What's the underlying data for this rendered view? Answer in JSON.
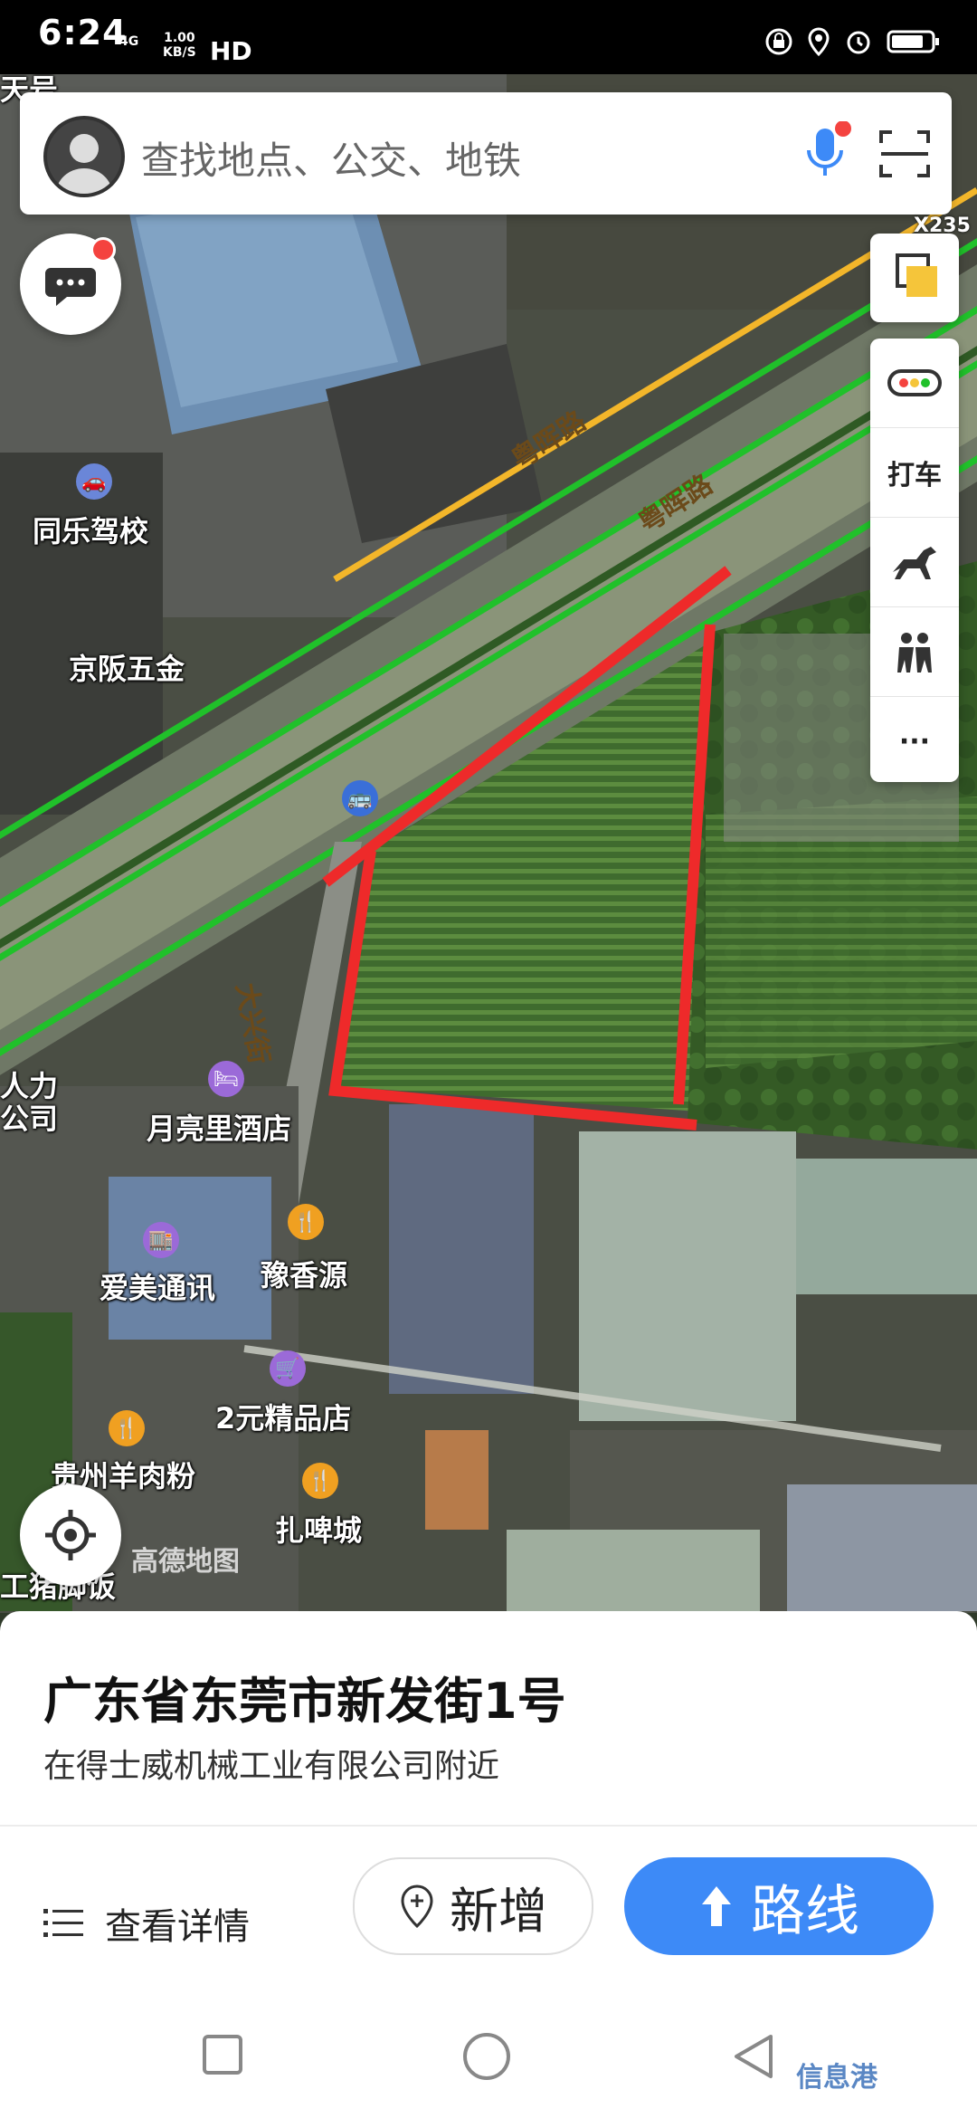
{
  "status_bar": {
    "time": "6:24",
    "network": "4G",
    "speed_value": "1.00",
    "speed_unit": "KB/S",
    "hd": "HD"
  },
  "search": {
    "placeholder": "查找地点、公交、地铁"
  },
  "map": {
    "scale_tag": "X235",
    "roads": [
      "粤晖路",
      "粤晖路",
      "大兴街"
    ],
    "pois": [
      {
        "name": "同乐驾校",
        "icon": "car-icon"
      },
      {
        "name": "京阪五金",
        "icon": "dot-icon"
      },
      {
        "name": "月亮里酒店",
        "icon": "bed-icon"
      },
      {
        "name": "人力\n公司",
        "icon": "none"
      },
      {
        "name": "豫香源",
        "icon": "restaurant-icon"
      },
      {
        "name": "爱美通讯",
        "icon": "shop-icon"
      },
      {
        "name": "2元精品店",
        "icon": "cart-icon"
      },
      {
        "name": "贵州羊肉粉",
        "icon": "restaurant-icon"
      },
      {
        "name": "扎啤城",
        "icon": "restaurant-icon"
      },
      {
        "name": "工猪脚饭",
        "icon": "restaurant-icon"
      }
    ],
    "logo_text": "高德地图",
    "top_left_partial": "天号"
  },
  "tools": {
    "taxi_label": "打车",
    "more": "···"
  },
  "sheet": {
    "address": "广东省东莞市新发街1号",
    "nearby": "在得士威机械工业有限公司附近",
    "detail_label": "查看详情",
    "add_label": "新增",
    "route_label": "路线"
  },
  "watermark": "信息港"
}
